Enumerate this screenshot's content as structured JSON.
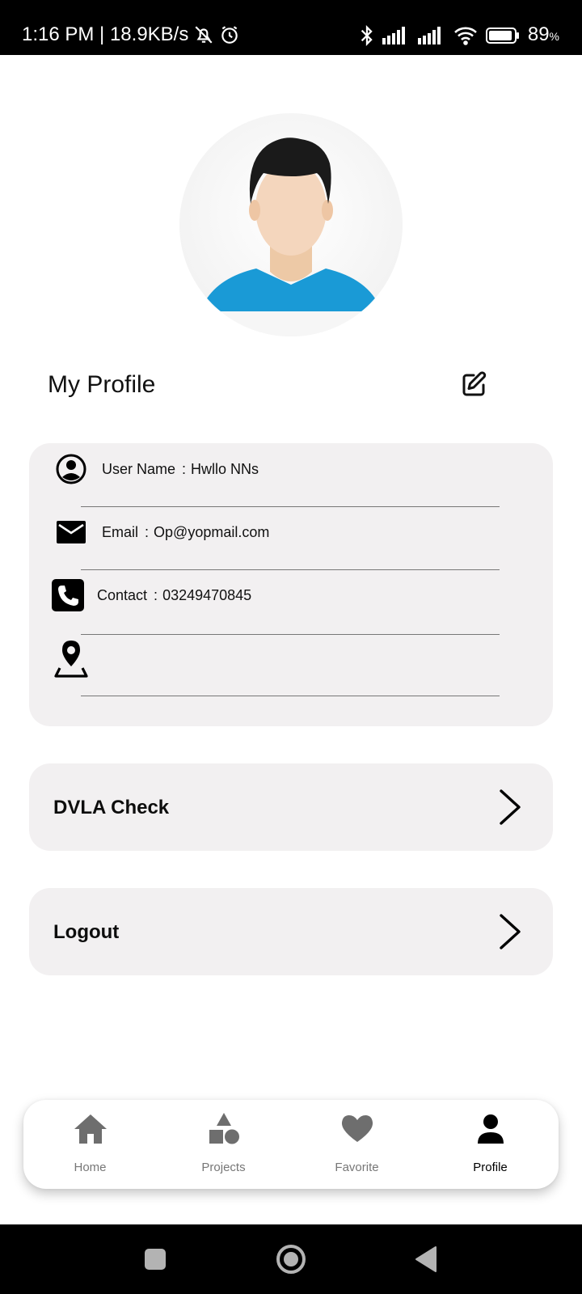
{
  "status_bar": {
    "time_speed": "1:16 PM | 18.9KB/s",
    "battery_percent": "89",
    "battery_unit": "%"
  },
  "profile": {
    "title": "My Profile"
  },
  "info": {
    "username_label": "User Name",
    "username_value": "Hwllo NNs",
    "email_label": "Email",
    "email_value": "Op@yopmail.com",
    "contact_label": "Contact",
    "contact_value": "03249470845",
    "separator": ":"
  },
  "actions": {
    "dvla_label": "DVLA Check",
    "logout_label": "Logout"
  },
  "bottom_nav": {
    "items": [
      {
        "label": "Home",
        "icon": "home-icon",
        "active": false
      },
      {
        "label": "Projects",
        "icon": "shapes-icon",
        "active": false
      },
      {
        "label": "Favorite",
        "icon": "heart-icon",
        "active": false
      },
      {
        "label": "Profile",
        "icon": "person-icon",
        "active": true
      }
    ]
  },
  "colors": {
    "card_bg": "#f2f0f1",
    "shirt_blue": "#1a9ad6",
    "nav_inactive": "#777777",
    "nav_active": "#000000"
  }
}
